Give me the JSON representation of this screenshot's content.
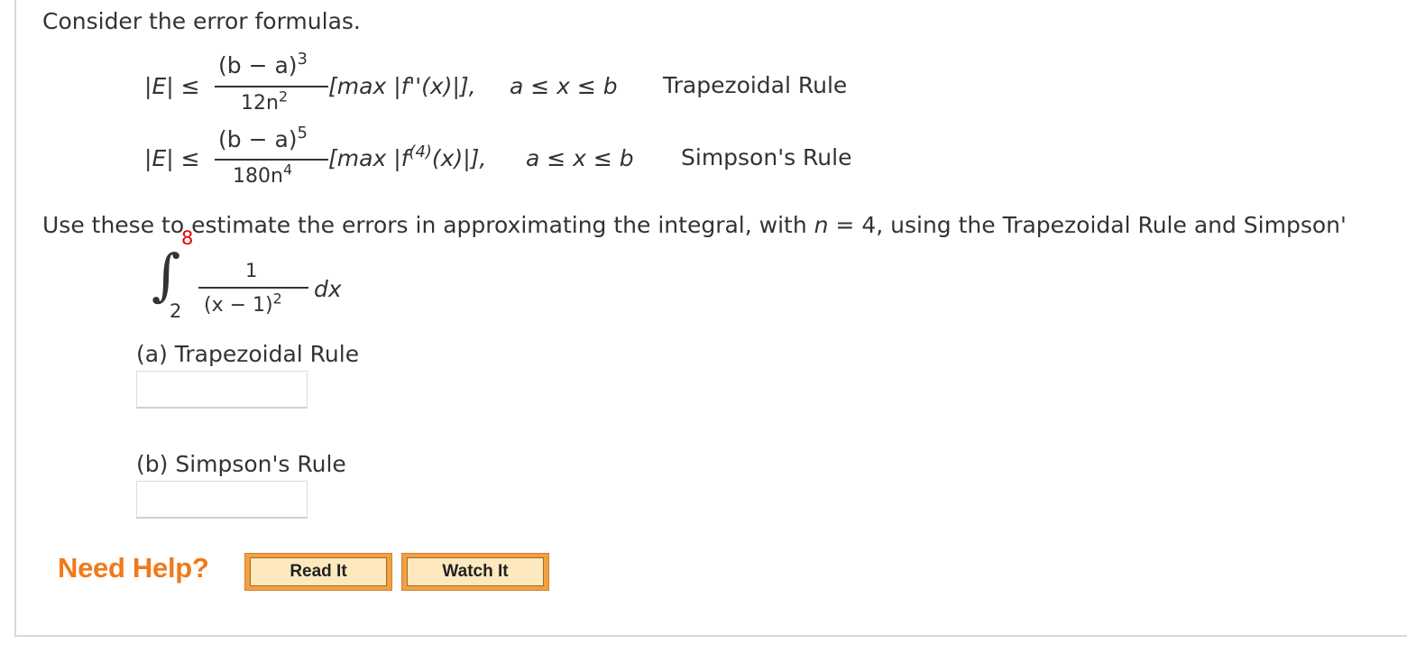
{
  "intro": "Consider the error formulas.",
  "formulas": {
    "trap": {
      "lhs_pre": "|",
      "lhs_var": "E",
      "lhs_post": "| ≤",
      "num": "(b − a)",
      "num_exp": "3",
      "den": "12n",
      "den_exp": "2",
      "bracket_open": "[",
      "max": "max",
      "abs": "|f''(x)|",
      "bracket_close": "],",
      "domain": "a ≤ x ≤ b",
      "rule": "Trapezoidal Rule"
    },
    "simp": {
      "lhs_pre": "|",
      "lhs_var": "E",
      "lhs_post": "| ≤",
      "num": "(b − a)",
      "num_exp": "5",
      "den": "180n",
      "den_exp": "4",
      "bracket_open": "[",
      "max": "max",
      "abs_pre": "|f",
      "abs_exp": "(4)",
      "abs_post": "(x)|",
      "bracket_close": "],",
      "domain": "a ≤ x ≤ b",
      "rule": "Simpson's Rule"
    }
  },
  "instruction": {
    "pre": "Use these to estimate the errors in approximating the integral, with ",
    "var": "n",
    "post": " = 4, using the Trapezoidal Rule and Simpson'"
  },
  "integral": {
    "symbol": "∫",
    "upper": "8",
    "lower": "2",
    "numerator": "1",
    "denominator": "(x − 1)",
    "den_exp": "2",
    "dx": "dx"
  },
  "parts": {
    "a_label": "(a) Trapezoidal Rule",
    "a_value": "",
    "b_label": "(b) Simpson's Rule",
    "b_value": ""
  },
  "help": {
    "label": "Need Help?",
    "read_it": "Read It",
    "watch_it": "Watch It"
  },
  "colors": {
    "text": "#333333",
    "limit_highlight": "#e60000",
    "need_help": "#f07a1b",
    "button_outer": "#f3a042",
    "button_inner": "#fde9bd"
  }
}
